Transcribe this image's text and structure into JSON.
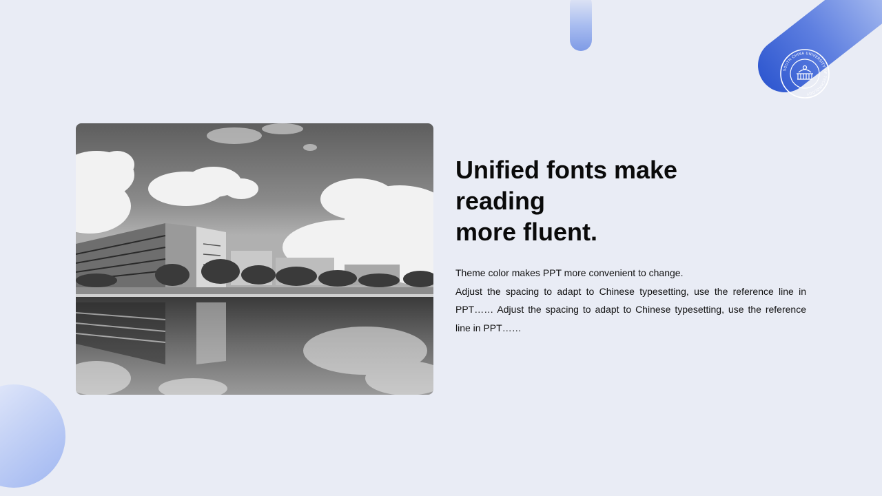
{
  "heading": {
    "line1": "Unified fonts make",
    "line2": "reading",
    "line3": "more fluent."
  },
  "body": {
    "line1": "Theme color makes PPT more convenient  to change.",
    "paragraph": "Adjust the spacing to adapt to Chinese typesetting, use the reference line in PPT…… Adjust the spacing to adapt to Chinese typesetting, use the reference line in PPT……"
  },
  "badge": {
    "text": "SOUTH CHINA UNIVERSITY OF TECHNOLOGY",
    "icon": "university-seal"
  },
  "photo": {
    "icon": "campus-building-photo",
    "style": "grayscale"
  },
  "colors": {
    "background": "#e9ecf5",
    "accent": "#2f58d0",
    "accent_light": "#a8bcf0"
  }
}
